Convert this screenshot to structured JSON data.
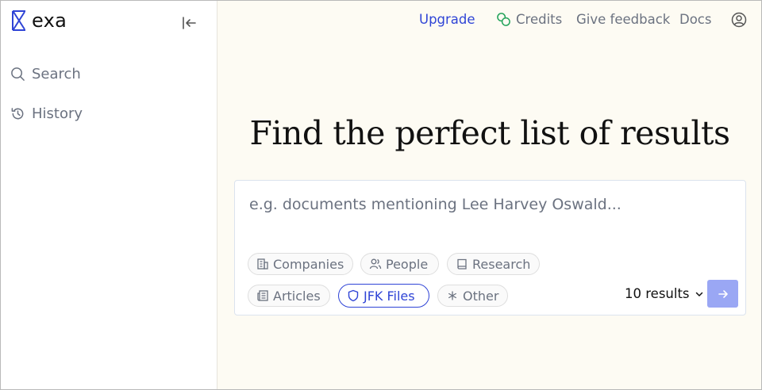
{
  "brand": {
    "name": "exa",
    "accent": "#2f44d6"
  },
  "sidebar": {
    "collapse_icon": "collapse-left-icon",
    "items": [
      {
        "label": "Search",
        "icon": "search-icon"
      },
      {
        "label": "History",
        "icon": "history-icon"
      }
    ]
  },
  "topbar": {
    "upgrade": "Upgrade",
    "credits": "Credits",
    "feedback": "Give feedback",
    "docs": "Docs"
  },
  "main": {
    "headline": "Find the perfect list of results",
    "search_placeholder": "e.g. documents mentioning Lee Harvey Oswald...",
    "categories": [
      {
        "label": "Companies",
        "icon": "building-icon",
        "active": false
      },
      {
        "label": "People",
        "icon": "people-icon",
        "active": false
      },
      {
        "label": "Research",
        "icon": "book-icon",
        "active": false
      },
      {
        "label": "Articles",
        "icon": "newspaper-icon",
        "active": false
      },
      {
        "label": "JFK Files",
        "icon": "shield-icon",
        "active": true
      },
      {
        "label": "Other",
        "icon": "asterisk-icon",
        "active": false
      }
    ],
    "results_count": "10 results",
    "submit_color": "#9aa7f4"
  }
}
